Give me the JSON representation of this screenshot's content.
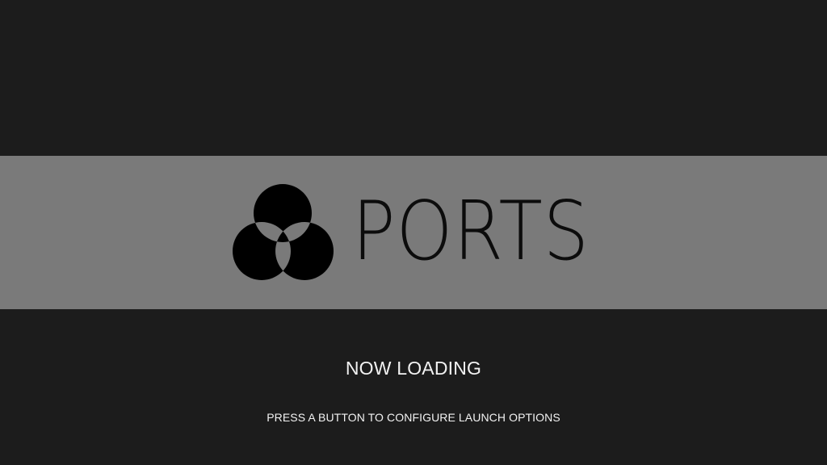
{
  "logo": {
    "wordmark": "PORTS",
    "icon": "three-circles-logo-icon",
    "mark_color": "#000000",
    "banner_color": "#7a7a7a"
  },
  "status": {
    "loading_text": "NOW LOADING",
    "hint_text": "PRESS A BUTTON TO CONFIGURE LAUNCH OPTIONS"
  },
  "colors": {
    "background": "#1c1c1c",
    "text": "#f2f2f2"
  }
}
